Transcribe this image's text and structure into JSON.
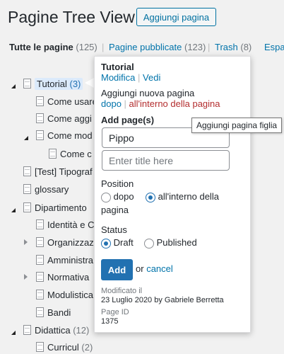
{
  "header": {
    "title": "Pagine Tree View",
    "add_button": "Aggiungi pagina"
  },
  "filters": [
    {
      "label": "Tutte le pagine",
      "count": "(125)"
    },
    {
      "label": "Pagine pubblicate",
      "count": "(123)"
    },
    {
      "label": "Trash",
      "count": "(8)"
    },
    {
      "label": "Espa",
      "count": ""
    }
  ],
  "tree": [
    {
      "label": "Tutorial",
      "count": "(3)"
    },
    {
      "label": "Come usare"
    },
    {
      "label": "Come aggi"
    },
    {
      "label": "Come mod"
    },
    {
      "label": "Come c"
    },
    {
      "label": "[Test] Tipograf"
    },
    {
      "label": "glossary"
    },
    {
      "label": "Dipartimento"
    },
    {
      "label": "Identità e C"
    },
    {
      "label": "Organizzaz"
    },
    {
      "label": "Amministra"
    },
    {
      "label": "Normativa"
    },
    {
      "label": "Modulistica"
    },
    {
      "label": "Bandi"
    },
    {
      "label": "Didattica",
      "count": "(12)"
    },
    {
      "label": "Curricul",
      "count": "(2)"
    }
  ],
  "popup": {
    "title": "Tutorial",
    "edit": "Modifica",
    "view": "Vedi",
    "add_new": "Aggiungi nuova pagina",
    "after": "dopo",
    "inside": "all'interno della pagina",
    "add_pages_label": "Add page(s)",
    "field1_value": "Pippo",
    "field2_placeholder": "Enter title here",
    "position_label": "Position",
    "pos_after": "dopo",
    "pos_inside_1": "all'interno della",
    "pos_inside_2": "pagina",
    "status_label": "Status",
    "status_draft": "Draft",
    "status_published": "Published",
    "add_button": "Add",
    "or": "or",
    "cancel": "cancel",
    "modified_label": "Modificato il",
    "modified_value": "23 Luglio 2020 by Gabriele Berretta",
    "page_id_label": "Page ID",
    "page_id_value": "1375"
  },
  "tooltip": "Aggiungi pagina figlia",
  "colors": {
    "link": "#0073aa",
    "primary": "#2271b1",
    "inside_link": "#b32d2e"
  }
}
